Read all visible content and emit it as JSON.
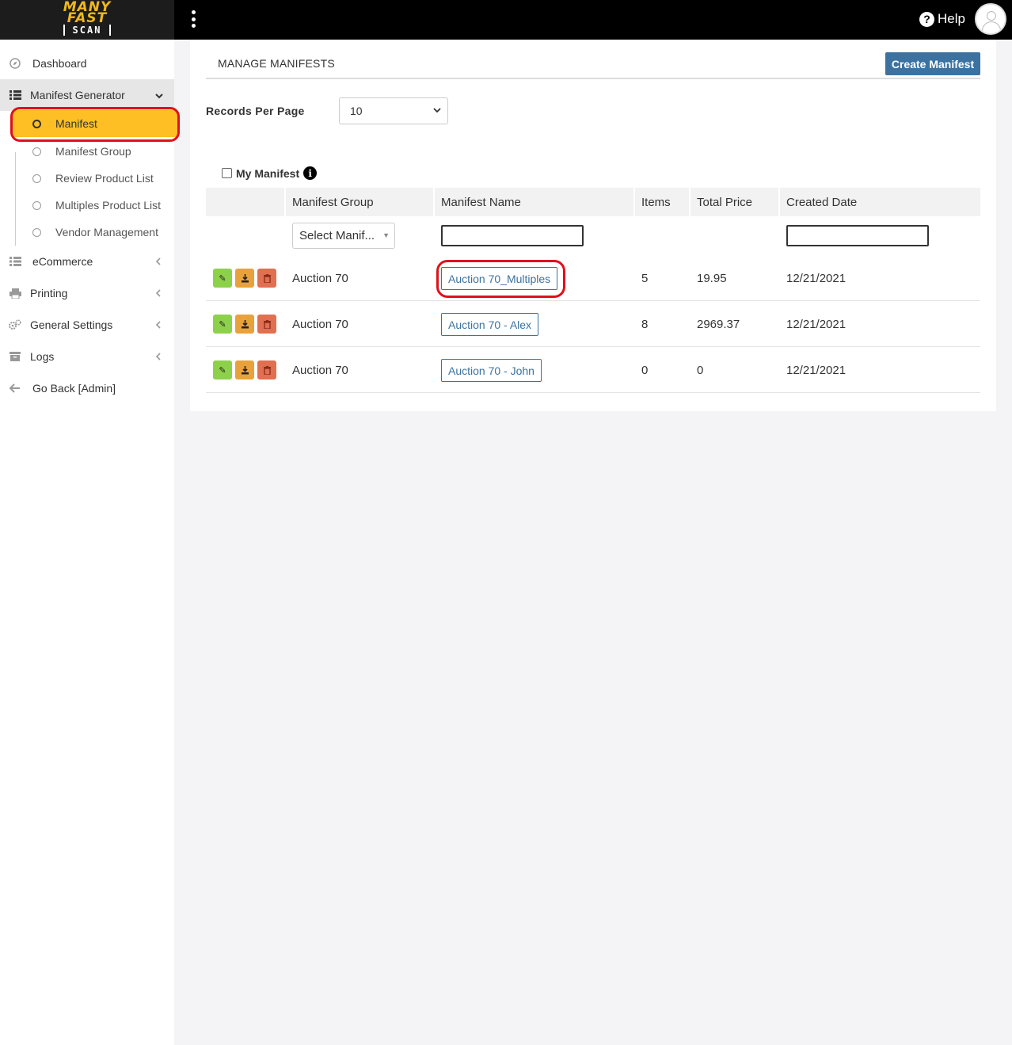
{
  "app": {
    "logo_line1": "MANY",
    "logo_line2": "FAST",
    "logo_line3": "SCAN",
    "help_label": "Help"
  },
  "sidebar": {
    "items": [
      {
        "label": "Dashboard",
        "icon": "compass-icon"
      },
      {
        "label": "Manifest Generator",
        "icon": "list-icon"
      },
      {
        "label": "eCommerce",
        "icon": "list-icon"
      },
      {
        "label": "Printing",
        "icon": "printer-icon"
      },
      {
        "label": "General Settings",
        "icon": "gears-icon"
      },
      {
        "label": "Logs",
        "icon": "archive-icon"
      },
      {
        "label": "Go Back [Admin]",
        "icon": "arrow-left-icon"
      }
    ],
    "subitems": [
      {
        "label": "Manifest"
      },
      {
        "label": "Manifest Group"
      },
      {
        "label": "Review Product List"
      },
      {
        "label": "Multiples Product List"
      },
      {
        "label": "Vendor Management"
      }
    ]
  },
  "main": {
    "title": "MANAGE MANIFESTS",
    "create_button": "Create Manifest",
    "records_per_page_label": "Records Per Page",
    "records_per_page_value": "10",
    "my_manifest_label": "My Manifest",
    "table": {
      "columns": [
        "Manifest Group",
        "Manifest Name",
        "Items",
        "Total Price",
        "Created Date"
      ],
      "group_filter_placeholder": "Select Manif...",
      "rows": [
        {
          "group": "Auction 70",
          "name": "Auction 70_Multiples",
          "items": "5",
          "price": "19.95",
          "date": "12/21/2021"
        },
        {
          "group": "Auction 70",
          "name": "Auction 70 - Alex",
          "items": "8",
          "price": "2969.37",
          "date": "12/21/2021"
        },
        {
          "group": "Auction 70",
          "name": "Auction 70 - John",
          "items": "0",
          "price": "0",
          "date": "12/21/2021"
        }
      ]
    }
  },
  "colors": {
    "accent": "#3b72a0",
    "active_item": "#fdbf23",
    "highlight_outline": "#e0101a",
    "edit": "#8dd14a",
    "download": "#e9a23b",
    "delete": "#e07050"
  }
}
